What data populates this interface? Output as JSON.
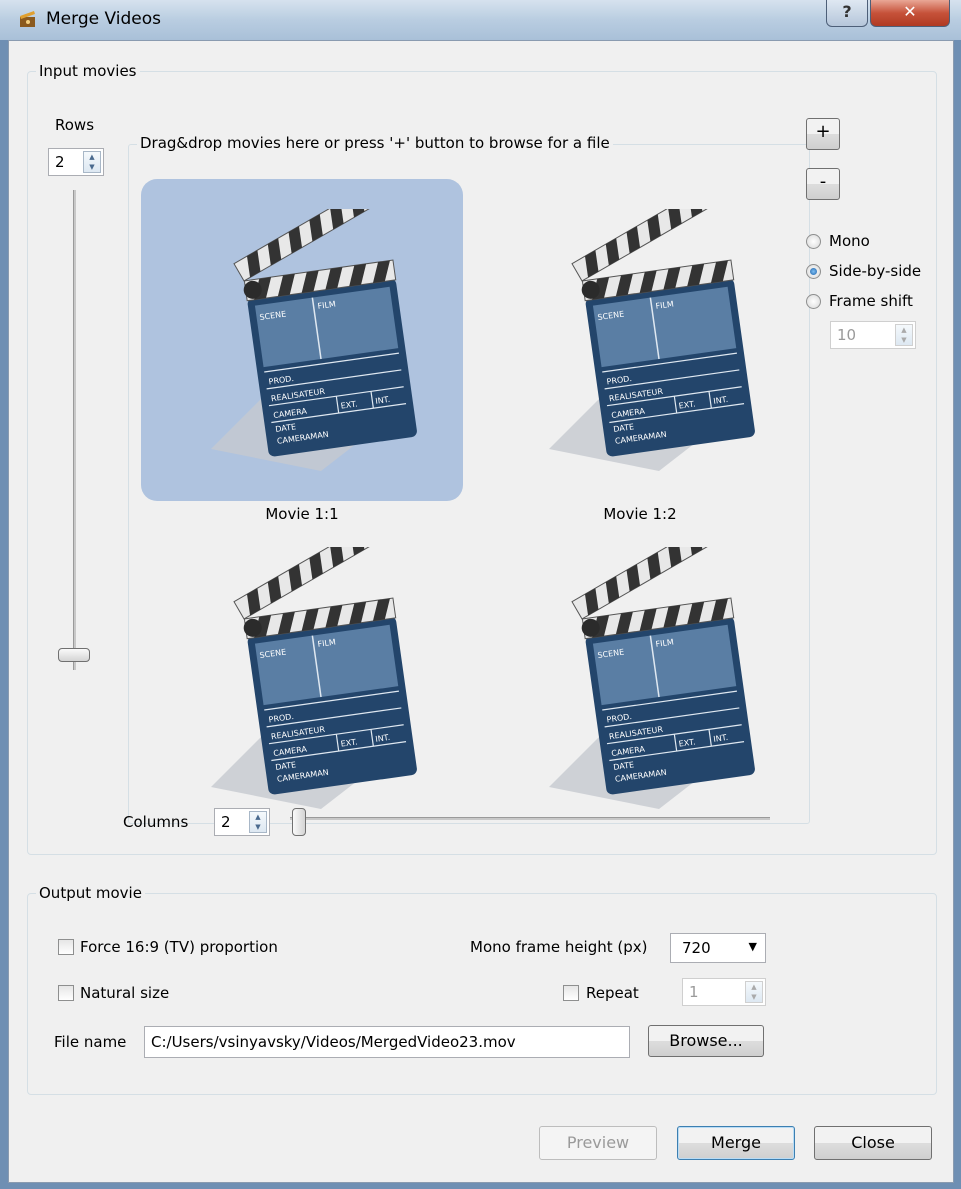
{
  "window": {
    "title": "Merge Videos",
    "help_glyph": "?",
    "close_glyph": "✕"
  },
  "input_group": {
    "title": "Input movies",
    "rows_label": "Rows",
    "rows_value": "2",
    "dropzone_title": "Drag&drop movies here or press '+' button to browse for a file",
    "add_button": "+",
    "remove_button": "-",
    "modes": [
      "Mono",
      "Side-by-side",
      "Frame shift"
    ],
    "selected_mode": "Side-by-side",
    "frame_shift_value": "10",
    "columns_label": "Columns",
    "columns_value": "2",
    "tiles": [
      {
        "caption": "Movie 1:1",
        "selected": true
      },
      {
        "caption": "Movie 1:2",
        "selected": false
      },
      {
        "caption": "",
        "selected": false
      },
      {
        "caption": "",
        "selected": false
      }
    ],
    "clapper_text": {
      "scene": "SCENE",
      "film": "FILM",
      "prod": "PROD.",
      "real": "REALISATEUR",
      "camera": "CAMERA",
      "ext": "EXT.",
      "int": "INT.",
      "date": "DATE",
      "cameraman": "CAMERAMAN"
    }
  },
  "output_group": {
    "title": "Output  movie",
    "force_169_label": "Force 16:9 (TV) proportion",
    "natural_size_label": "Natural size",
    "mono_height_label": "Mono frame height (px)",
    "mono_height_value": "720",
    "repeat_label": "Repeat",
    "repeat_value": "1",
    "filename_label": "File name",
    "filename_value": "C:/Users/vsinyavsky/Videos/MergedVideo23.mov",
    "browse_button": "Browse..."
  },
  "footer": {
    "preview": "Preview",
    "merge": "Merge",
    "close": "Close"
  }
}
